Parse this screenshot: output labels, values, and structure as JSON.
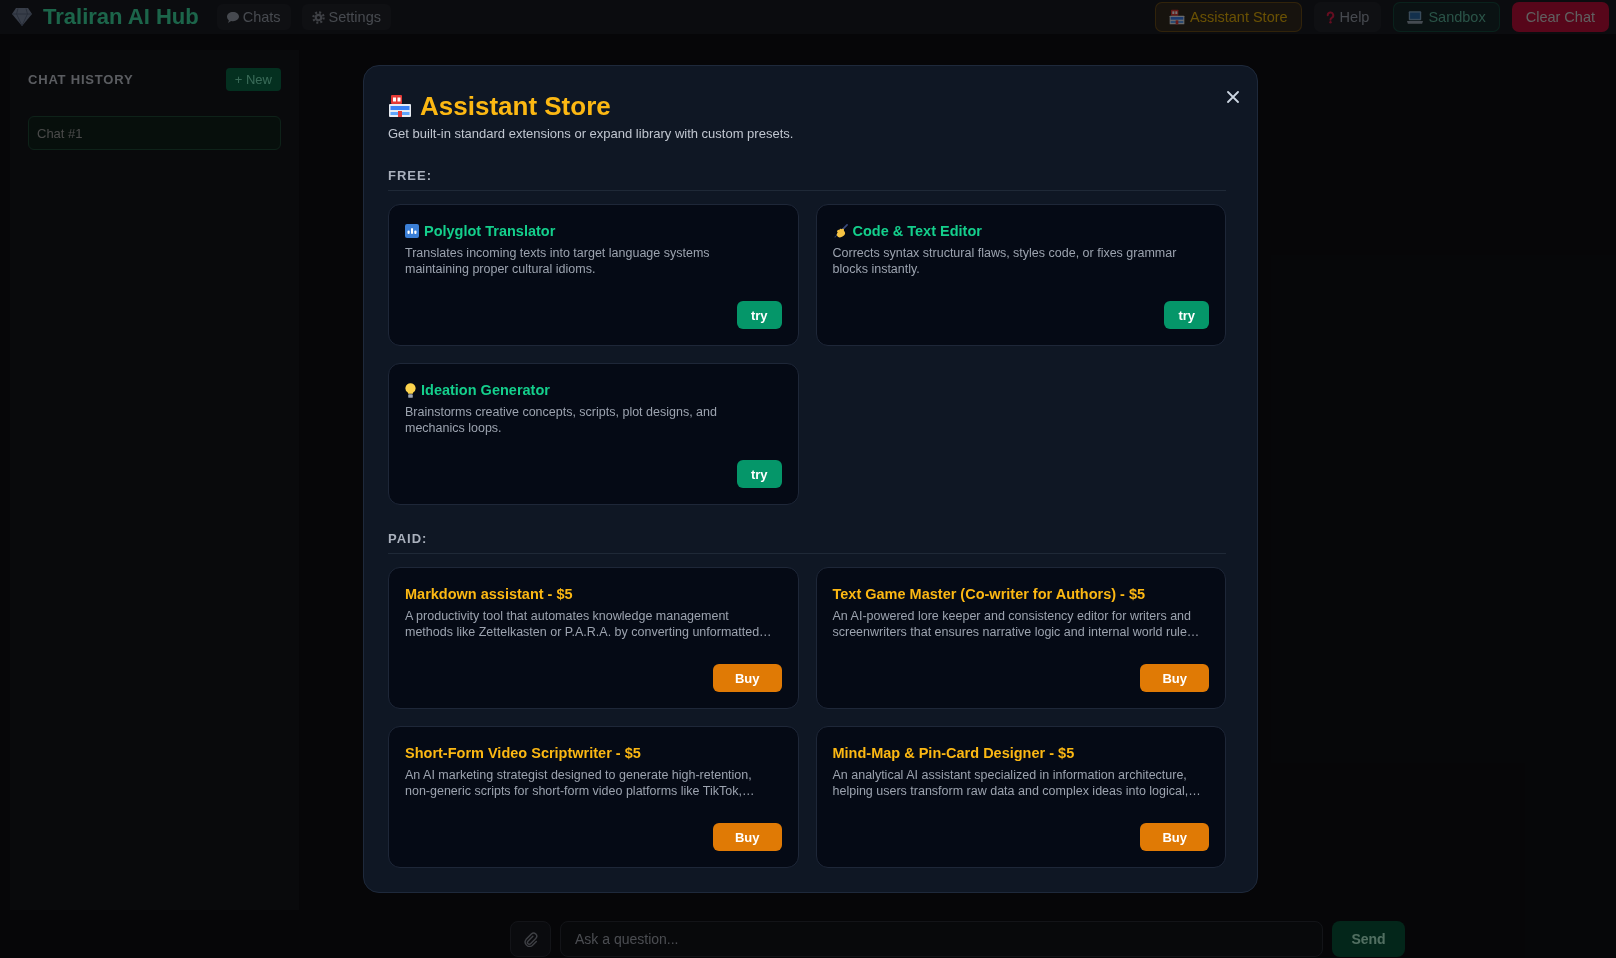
{
  "top_bar": {
    "brand": "Traliran AI Hub",
    "nav": [
      {
        "kind": "chats",
        "label": "Chats"
      },
      {
        "kind": "settings",
        "label": "Settings"
      }
    ],
    "actions": [
      {
        "kind": "store",
        "label": "Assistant Store"
      },
      {
        "kind": "help",
        "label": "Help"
      },
      {
        "kind": "sandbox",
        "label": "Sandbox"
      },
      {
        "kind": "danger",
        "label": "Clear Chat"
      }
    ]
  },
  "sidebar": {
    "title": "CHAT HISTORY",
    "new_button": "+ New",
    "chats": [
      {
        "label": "Chat #1",
        "selected": true
      }
    ]
  },
  "composer": {
    "placeholder": "Ask a question...",
    "send_button": "Send"
  },
  "dialog": {
    "title": "Assistant Store",
    "subtitle": "Get built-in standard extensions or expand library with custom presets.",
    "sections": [
      {
        "kind": "free",
        "label": "FREE:",
        "items": [
          {
            "title": "Polyglot Translator",
            "description": "Translates incoming texts into target language systems\nmaintaining proper cultural idioms.",
            "action": "try"
          },
          {
            "title": "Code & Text Editor",
            "description": "Corrects syntax structural flaws, styles code, or fixes grammar\nblocks instantly.",
            "action": "try"
          },
          {
            "title": "Ideation Generator",
            "description": "Brainstorms creative concepts, scripts, plot designs, and\nmechanics loops.",
            "action": "try"
          }
        ]
      },
      {
        "kind": "paid",
        "label": "PAID:",
        "items": [
          {
            "title": "Markdown assistant - $5",
            "description": "A productivity tool that automates knowledge management\nmethods like Zettelkasten or P.A.R.A. by converting unformatted…",
            "action": "Buy"
          },
          {
            "title": "Text Game Master (Co-writer for Authors) - $5",
            "description": "An AI-powered lore keeper and consistency editor for writers and\nscreenwriters that ensures narrative logic and internal world rule…",
            "action": "Buy"
          },
          {
            "title": "Short-Form Video Scriptwriter - $5",
            "description": "An AI marketing strategist designed to generate high-retention,\nnon-generic scripts for short-form video platforms like TikTok,…",
            "action": "Buy"
          },
          {
            "title": "Mind-Map & Pin-Card Designer - $5",
            "description": "An analytical AI assistant specialized in information architecture,\nhelping users transform raw data and complex ideas into logical,…",
            "action": "Buy"
          }
        ]
      }
    ]
  }
}
